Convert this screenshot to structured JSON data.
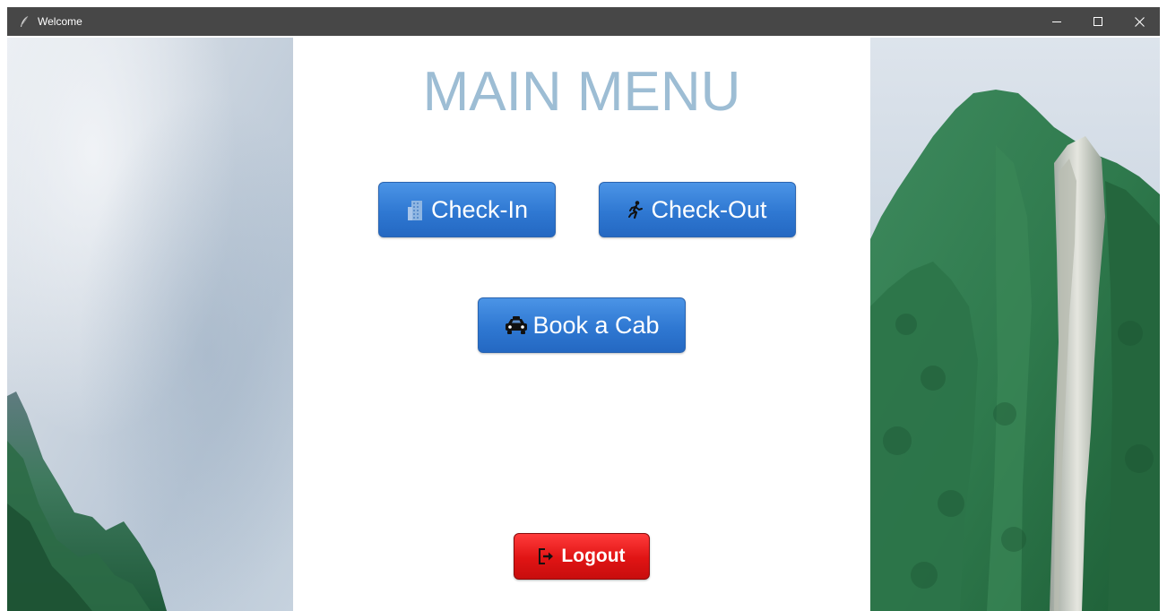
{
  "window": {
    "title": "Welcome",
    "icon": "feather-icon",
    "controls": [
      "minimize-icon",
      "maximize-icon",
      "close-icon"
    ]
  },
  "main": {
    "heading": "MAIN MENU",
    "buttons": {
      "checkin": {
        "label": "Check-In",
        "icon": "building-icon"
      },
      "checkout": {
        "label": "Check-Out",
        "icon": "running-person-icon"
      },
      "cab": {
        "label": "Book a Cab",
        "icon": "taxi-icon"
      },
      "logout": {
        "label": "Logout",
        "icon": "logout-icon"
      }
    }
  },
  "colors": {
    "titlebar": "#474747",
    "heading": "#9dbdd4",
    "primary_button": "#2f78d2",
    "logout_button": "#e01414"
  }
}
